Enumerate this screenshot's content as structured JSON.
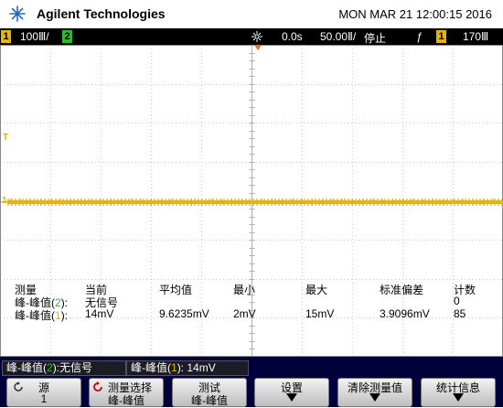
{
  "header": {
    "brand": "Agilent Technologies",
    "datetime": "MON MAR 21 12:00:15 2016"
  },
  "status_bar": {
    "ch1_number": "1",
    "ch1_scale": "100Ⅲ/",
    "ch2_number": "2",
    "time_delay": "0.0s",
    "time_scale": "50.00Ⅱ/",
    "run_state": "停止",
    "trigger_symbol": "ƒ",
    "trigger_channel": "1",
    "trigger_level": "170Ⅲ"
  },
  "colors": {
    "channel1": "#e8b400",
    "channel2": "#2eb82e",
    "softkey_bar": "#00003a"
  },
  "measurements": {
    "headers": [
      "测量",
      "当前",
      "平均值",
      "最小",
      "最大",
      "标准偏差",
      "计数"
    ],
    "rows": [
      {
        "name_prefix": "峰-峰值(",
        "channel": "2",
        "name_suffix": "):",
        "current": "无信号",
        "mean": "",
        "min": "",
        "max": "",
        "std": "",
        "count": "0"
      },
      {
        "name_prefix": "峰-峰值(",
        "channel": "1",
        "name_suffix": "):",
        "current": "14mV",
        "mean": "9.6235mV",
        "min": "2mV",
        "max": "15mV",
        "std": "3.9096mV",
        "count": "85"
      }
    ]
  },
  "measurement_labels": [
    {
      "prefix": "峰-峰值(",
      "channel": "2",
      "value": "):无信号"
    },
    {
      "prefix": "峰-峰值(",
      "channel": "1",
      "value": "): 14mV"
    }
  ],
  "softkeys": [
    {
      "line1": "源",
      "line2": "1",
      "icon": "rotate-knob-icon"
    },
    {
      "line1": "测量选择",
      "line2": "峰-峰值",
      "icon": "rotate-knob-icon"
    },
    {
      "line1": "测试",
      "line2": "峰-峰值"
    },
    {
      "line1": "设置",
      "icon": "arrow-down-icon"
    },
    {
      "line1": "清除测量值",
      "icon": "arrow-down-icon"
    },
    {
      "line1": "统计信息",
      "icon": "arrow-down-icon"
    }
  ],
  "markers": {
    "ch1_ground": "1",
    "trigger_level": "T"
  }
}
